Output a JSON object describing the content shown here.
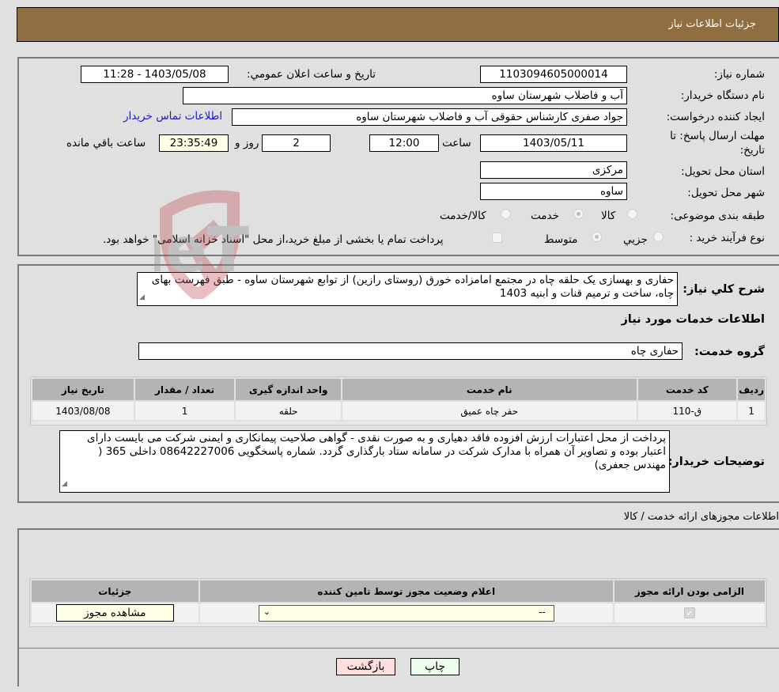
{
  "header": {
    "title": "جزئیات اطلاعات نیاز"
  },
  "form": {
    "need_number": {
      "label": "شماره نیاز:",
      "value": "1103094605000014"
    },
    "announce_datetime": {
      "label": "تاریخ و ساعت اعلان عمومي:",
      "value": "1403/05/08 - 11:28"
    },
    "buyer_org": {
      "label": "نام دستگاه خریدار:",
      "value": "آب و فاضلاب شهرستان ساوه"
    },
    "requester": {
      "label": "ایجاد کننده درخواست:",
      "value": "جواد صفری کارشناس حقوقی آب و فاضلاب شهرستان ساوه"
    },
    "buyer_contact_link": "اطلاعات تماس خریدار",
    "deadline": {
      "label_line1": "مهلت ارسال پاسخ: تا",
      "label_line2": "تاریخ:",
      "date": "1403/05/11",
      "time_label": "ساعت",
      "time": "12:00",
      "days": "2",
      "days_label": "روز و",
      "remaining": "23:35:49",
      "remaining_label": "ساعت باقي مانده"
    },
    "province": {
      "label": "استان محل تحویل:",
      "value": "مرکزی"
    },
    "city": {
      "label": "شهر محل تحویل:",
      "value": "ساوه"
    },
    "category": {
      "label": "طبقه بندی موضوعی:",
      "options": [
        "کالا",
        "خدمت",
        "کالا/خدمت"
      ],
      "selected": "خدمت"
    },
    "purchase_type": {
      "label": "نوع فرآیند خرید :",
      "options": [
        "جزيي",
        "متوسط"
      ],
      "selected": "متوسط",
      "treasury_note": "پرداخت تمام یا بخشی از مبلغ خرید،از محل \"اسناد خزانه اسلامی\" خواهد بود.",
      "treasury_checked": false
    }
  },
  "summary": {
    "label": "شرح کلي نیاز:",
    "text": "حفاری و بهسازی یک حلقه چاه در مجتمع امامزاده خورق (روستای رازین) از توابع شهرستان ساوه - طبق فهرست بهای چاه، ساخت و ترمیم قنات و ابنیه 1403"
  },
  "services": {
    "section_title": "اطلاعات خدمات مورد نیاز",
    "group_label": "گروه خدمت:",
    "group_value": "حفاری چاه",
    "columns": [
      "ردیف",
      "کد خدمت",
      "نام خدمت",
      "واحد اندازه گیری",
      "تعداد / مقدار",
      "تاریخ نیاز"
    ],
    "rows": [
      [
        "1",
        "ق-110",
        "حفر چاه عمیق",
        "حلقه",
        "1",
        "1403/08/08"
      ]
    ]
  },
  "buyer_notes": {
    "label": "توضیحات خریدار:",
    "text": "پرداخت از محل اعتبارات ارزش افزوده فاقد دهیاری و به صورت نقدی - گواهی صلاحیت پیمانکاری و ایمنی شرکت می بایست دارای اعتبار بوده و تصاویر آن همراه با مدارک شرکت در سامانه ستاد بارگذاری گردد. شماره پاسخگویی 08642227006 داخلی 365 ( مهندس جعفری)"
  },
  "permits": {
    "section_title": "اطلاعات مجوزهای ارائه خدمت / کالا",
    "columns": [
      "الزامی بودن ارائه مجوز",
      "اعلام وضعیت مجوز توسط تامین کننده",
      "جزئیات"
    ],
    "rows": [
      {
        "required_checked": true,
        "status_value": "--",
        "details_button": "مشاهده مجوز"
      }
    ]
  },
  "actions": {
    "print": "چاپ",
    "back": "بازگشت"
  },
  "watermark": {
    "text": "AriaTender.neT"
  }
}
